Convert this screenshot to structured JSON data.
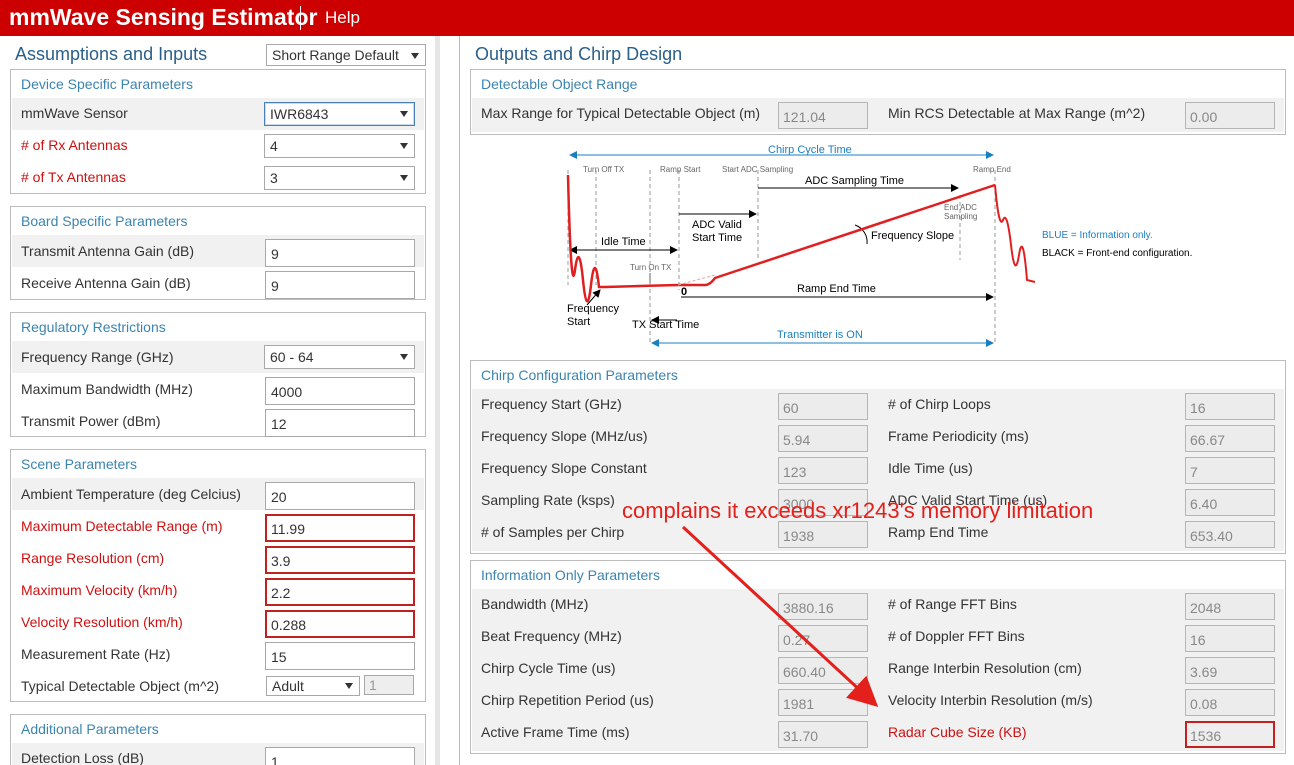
{
  "app": {
    "title": "mmWave Sensing Estimator",
    "help_label": "Help"
  },
  "left": {
    "header": "Assumptions and Inputs",
    "preset": "Short Range Default",
    "device": {
      "title": "Device Specific Parameters",
      "sensor_label": "mmWave Sensor",
      "sensor_value": "IWR6843",
      "rx_label": "# of Rx Antennas",
      "rx_value": "4",
      "tx_label": "# of Tx Antennas",
      "tx_value": "3"
    },
    "board": {
      "title": "Board Specific Parameters",
      "tx_gain_label": "Transmit Antenna Gain (dB)",
      "tx_gain_value": "9",
      "rx_gain_label": "Receive Antenna Gain (dB)",
      "rx_gain_value": "9"
    },
    "regulatory": {
      "title": "Regulatory Restrictions",
      "freq_range_label": "Frequency Range (GHz)",
      "freq_range_value": "60 - 64",
      "max_bw_label": "Maximum Bandwidth (MHz)",
      "max_bw_value": "4000",
      "tx_power_label": "Transmit Power (dBm)",
      "tx_power_value": "12"
    },
    "scene": {
      "title": "Scene Parameters",
      "ambient_label": "Ambient Temperature (deg Celcius)",
      "ambient_value": "20",
      "max_range_label": "Maximum Detectable Range (m)",
      "max_range_value": "11.99",
      "range_res_label": "Range Resolution (cm)",
      "range_res_value": "3.9",
      "max_vel_label": "Maximum Velocity (km/h)",
      "max_vel_value": "2.2",
      "vel_res_label": "Velocity Resolution (km/h)",
      "vel_res_value": "0.288",
      "meas_rate_label": "Measurement Rate (Hz)",
      "meas_rate_value": "15",
      "object_label": "Typical Detectable Object (m^2)",
      "object_value": "Adult",
      "object_rcs": "1"
    },
    "additional": {
      "title": "Additional Parameters",
      "det_loss_label": "Detection Loss (dB)",
      "det_loss_value": "1"
    }
  },
  "right": {
    "header": "Outputs and Chirp Design",
    "detectable": {
      "title": "Detectable Object Range",
      "max_range_label": "Max Range for Typical Detectable Object (m)",
      "max_range_value": "121.04",
      "min_rcs_label": "Min RCS Detectable at Max Range (m^2)",
      "min_rcs_value": "0.00"
    },
    "diagram": {
      "chirp_cycle_time": "Chirp Cycle Time",
      "turn_off_tx": "Turn Off TX",
      "ramp_start": "Ramp Start",
      "start_adc_sampling": "Start ADC Sampling",
      "ramp_end": "Ramp End",
      "adc_sampling_time": "ADC Sampling Time",
      "end_adc": "End ADC",
      "sampling": "Sampling",
      "adc_valid": "ADC Valid",
      "start_time": "Start Time",
      "idle_time": "Idle Time",
      "frequency_slope": "Frequency Slope",
      "turn_on_tx": "Turn On TX",
      "zero": "0",
      "ramp_end_time": "Ramp End Time",
      "frequency": "Frequency",
      "start": "Start",
      "tx_start_time": "TX Start Time",
      "transmitter_on": "Transmitter is ON",
      "legend_blue": "BLUE = Information only.",
      "legend_black": "BLACK = Front-end configuration."
    },
    "chirp": {
      "title": "Chirp Configuration Parameters",
      "left": [
        {
          "label": "Frequency Start (GHz)",
          "value": "60"
        },
        {
          "label": "Frequency Slope (MHz/us)",
          "value": "5.94"
        },
        {
          "label": "Frequency Slope Constant",
          "value": "123"
        },
        {
          "label": "Sampling Rate (ksps)",
          "value": "3000"
        },
        {
          "label": "# of Samples per Chirp",
          "value": "1938"
        }
      ],
      "right": [
        {
          "label": "# of Chirp Loops",
          "value": "16"
        },
        {
          "label": "Frame Periodicity (ms)",
          "value": "66.67"
        },
        {
          "label": "Idle Time (us)",
          "value": "7"
        },
        {
          "label": "ADC Valid Start Time (us)",
          "value": "6.40"
        },
        {
          "label": "Ramp End Time",
          "value": "653.40"
        }
      ]
    },
    "info": {
      "title": "Information Only Parameters",
      "left": [
        {
          "label": "Bandwidth (MHz)",
          "value": "3880.16"
        },
        {
          "label": "Beat Frequency (MHz)",
          "value": "0.27"
        },
        {
          "label": "Chirp Cycle Time (us)",
          "value": "660.40"
        },
        {
          "label": "Chirp Repetition Period (us)",
          "value": "1981"
        },
        {
          "label": "Active Frame Time (ms)",
          "value": "31.70"
        }
      ],
      "right": [
        {
          "label": "# of Range FFT Bins",
          "value": "2048"
        },
        {
          "label": "# of Doppler FFT Bins",
          "value": "16"
        },
        {
          "label": "Range Interbin Resolution (cm)",
          "value": "3.69"
        },
        {
          "label": "Velocity Interbin Resolution (m/s)",
          "value": "0.08"
        },
        {
          "label": "Radar Cube Size (KB)",
          "value": "1536"
        }
      ]
    }
  },
  "annotation": {
    "text": "complains it exceeds xr1243's memory limitation",
    "color": "#e3201b"
  },
  "colors": {
    "brand_red": "#cc0000",
    "section_blue": "#3b84b0",
    "error_red": "#c42020"
  }
}
